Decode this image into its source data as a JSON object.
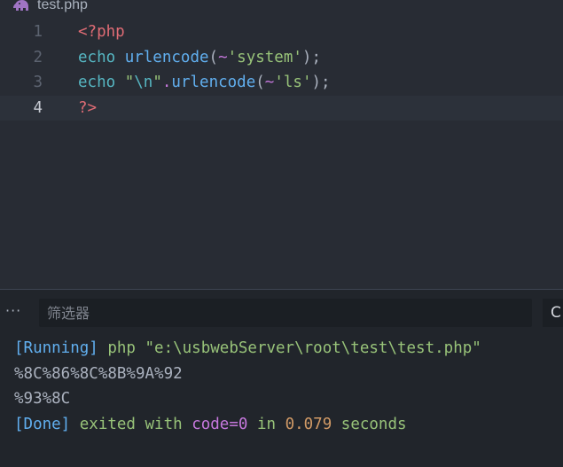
{
  "editor": {
    "filename": "test.php",
    "current_line": 4,
    "lines": [
      {
        "number": "1",
        "tokens": [
          {
            "text": "<?php",
            "kind": "tag"
          }
        ]
      },
      {
        "number": "2",
        "tokens": [
          {
            "text": "echo",
            "kind": "kw"
          },
          {
            "text": " ",
            "kind": "punc"
          },
          {
            "text": "urlencode",
            "kind": "fn"
          },
          {
            "text": "(",
            "kind": "punc"
          },
          {
            "text": "~",
            "kind": "op"
          },
          {
            "text": "'system'",
            "kind": "str"
          },
          {
            "text": ");",
            "kind": "punc"
          }
        ]
      },
      {
        "number": "3",
        "tokens": [
          {
            "text": "echo",
            "kind": "kw"
          },
          {
            "text": " ",
            "kind": "punc"
          },
          {
            "text": "\"",
            "kind": "str"
          },
          {
            "text": "\\n",
            "kind": "esc"
          },
          {
            "text": "\"",
            "kind": "str"
          },
          {
            "text": ".",
            "kind": "op"
          },
          {
            "text": "urlencode",
            "kind": "fn"
          },
          {
            "text": "(",
            "kind": "punc"
          },
          {
            "text": "~",
            "kind": "op"
          },
          {
            "text": "'ls'",
            "kind": "str"
          },
          {
            "text": ");",
            "kind": "punc"
          }
        ]
      },
      {
        "number": "4",
        "tokens": [
          {
            "text": "?>",
            "kind": "tag"
          }
        ]
      }
    ]
  },
  "panel": {
    "more_label": "···",
    "filter_placeholder": "筛选器",
    "filter_value": "",
    "side_button_label": "C",
    "output": [
      [
        {
          "text": "[Running]",
          "color": "blue"
        },
        {
          "text": " php \"e:\\usbwebServer\\root\\test\\test.php\"",
          "color": "green"
        }
      ],
      [
        {
          "text": "%8C%86%8C%8B%9A%92",
          "color": "plain"
        }
      ],
      [
        {
          "text": "%93%8C",
          "color": "plain"
        }
      ],
      [
        {
          "text": "[Done]",
          "color": "blue"
        },
        {
          "text": " exited with ",
          "color": "green"
        },
        {
          "text": "code=0",
          "color": "purple"
        },
        {
          "text": " in ",
          "color": "green"
        },
        {
          "text": "0.079",
          "color": "orange"
        },
        {
          "text": " seconds",
          "color": "green"
        }
      ]
    ]
  },
  "colors": {
    "editor_bg": "#282c34",
    "panel_bg": "#21252b",
    "current_line_bg": "#2c313a",
    "tag": "#e06c75",
    "keyword": "#56b6c2",
    "function": "#61afef",
    "operator": "#c678dd",
    "string": "#98c379",
    "number": "#d19a66"
  },
  "icons": {
    "file_type": "php-elephant-icon",
    "more": "ellipsis-icon"
  }
}
